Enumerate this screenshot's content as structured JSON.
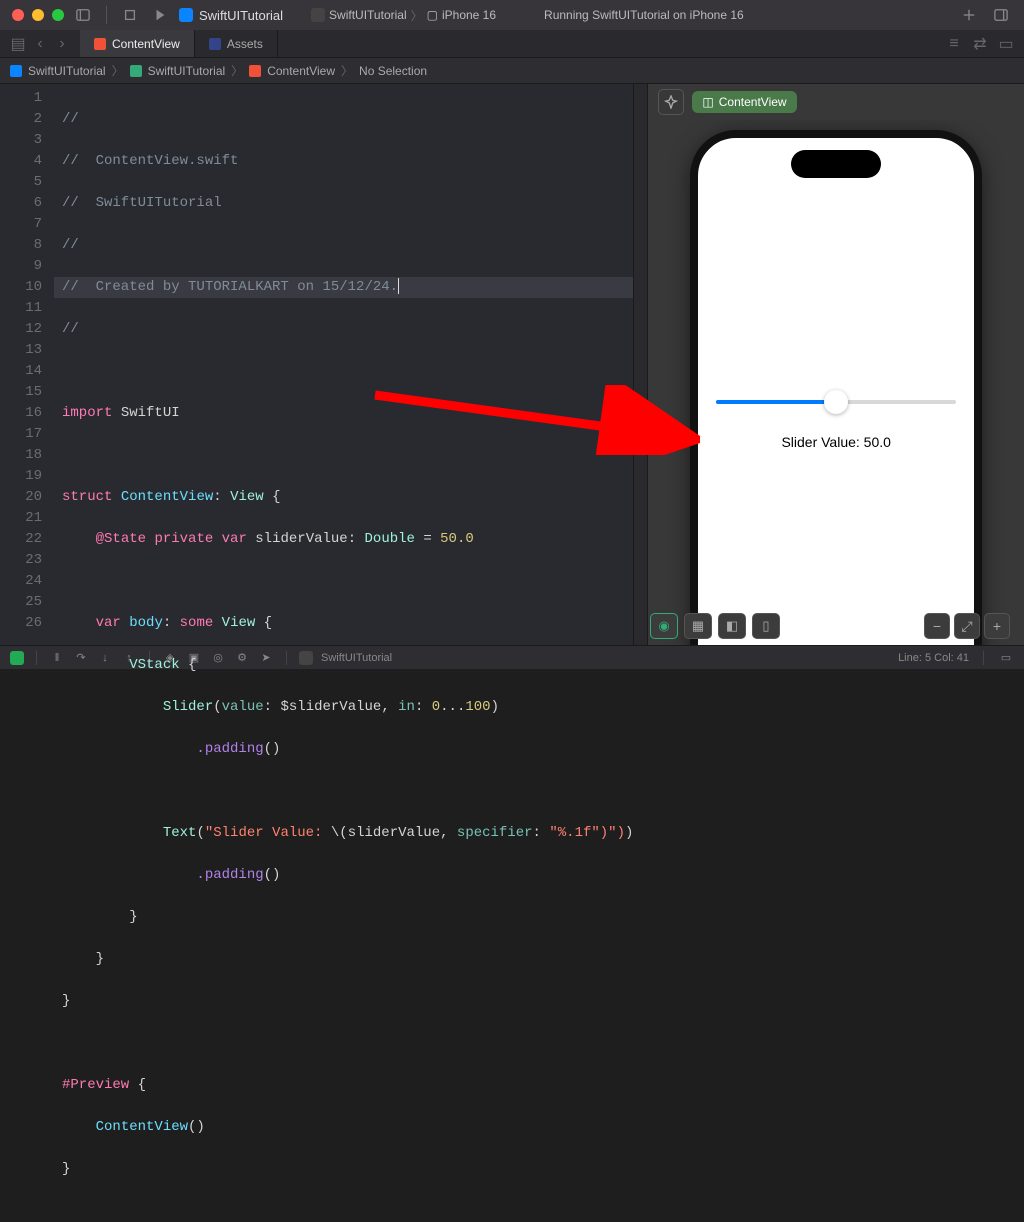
{
  "titlebar": {
    "project": "SwiftUITutorial",
    "scheme_app": "SwiftUITutorial",
    "scheme_device": "iPhone 16",
    "status": "Running SwiftUITutorial on iPhone 16"
  },
  "tabs": {
    "active": "ContentView",
    "second": "Assets"
  },
  "breadcrumb": {
    "b0": "SwiftUITutorial",
    "b1": "SwiftUITutorial",
    "b2": "ContentView",
    "b3": "No Selection"
  },
  "code": {
    "l1": "//",
    "l2": "//  ContentView.swift",
    "l3": "//  SwiftUITutorial",
    "l4": "//",
    "l5": "//  Created by TUTORIALKART on 15/12/24.",
    "l6": "//",
    "l8a": "import",
    "l8b": "SwiftUI",
    "l10a": "struct",
    "l10b": "ContentView",
    "l10c": "View",
    "l11a": "@State",
    "l11b": "private",
    "l11c": "var",
    "l11d": "sliderValue",
    "l11e": "Double",
    "l11f": "50.0",
    "l13a": "var",
    "l13b": "body",
    "l13c": "some",
    "l13d": "View",
    "l14a": "VStack",
    "l15a": "Slider",
    "l15b": "value",
    "l15c": "$sliderValue",
    "l15d": "in",
    "l15e": "0",
    "l15f": "100",
    "l16a": ".padding",
    "l18a": "Text",
    "l18b": "\"Slider Value: ",
    "l18c": "sliderValue",
    "l18d": "specifier",
    "l18e": "\"%.1f\"",
    "l18f": ")\")",
    "l19a": ".padding",
    "l24a": "#Preview",
    "l25a": "ContentView"
  },
  "preview": {
    "pill": "ContentView",
    "slider_text": "Slider Value: 50.0"
  },
  "bottombar": {
    "target": "SwiftUITutorial",
    "line_col": "Line: 5  Col: 41"
  },
  "gutter": [
    "1",
    "2",
    "3",
    "4",
    "5",
    "6",
    "7",
    "8",
    "9",
    "10",
    "11",
    "12",
    "13",
    "14",
    "15",
    "16",
    "17",
    "18",
    "19",
    "20",
    "21",
    "22",
    "23",
    "24",
    "25",
    "26"
  ]
}
